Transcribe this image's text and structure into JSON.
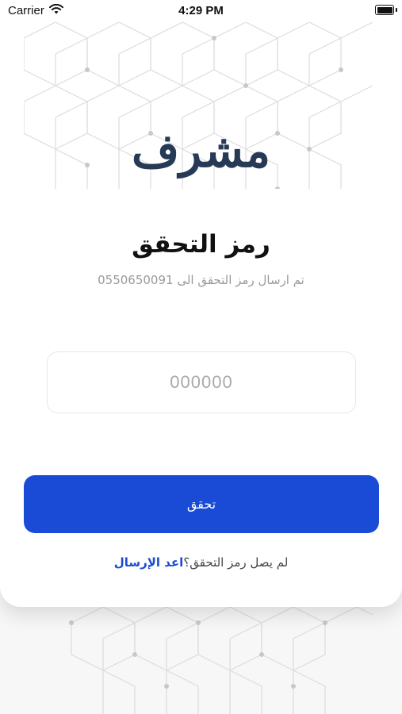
{
  "status_bar": {
    "carrier": "Carrier",
    "time": "4:29 PM",
    "icons": [
      "wifi-icon",
      "battery-icon"
    ]
  },
  "logo": {
    "text": "مشرف"
  },
  "title": "رمز التحقق",
  "subtitle": "تم ارسال رمز التحقق الى 0550650091",
  "code_field": {
    "placeholder": "000000",
    "value": ""
  },
  "verify_button": {
    "label": "تحقق"
  },
  "resend": {
    "prompt": "لم يصل رمز التحقق؟",
    "link": "اعد الإرسال"
  },
  "colors": {
    "accent": "#1a4bd6",
    "logo": "#263a55",
    "pattern": "#d4d4d4"
  }
}
